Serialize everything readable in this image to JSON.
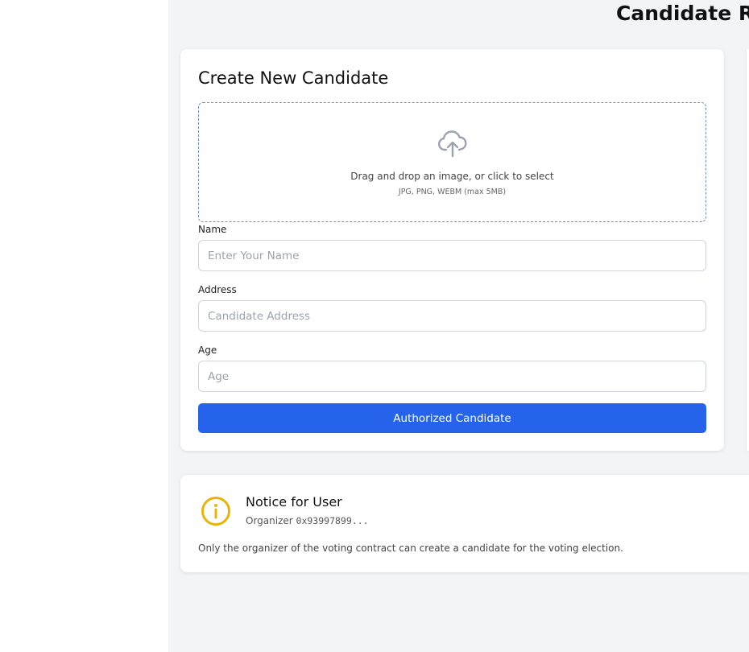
{
  "header": {
    "title": "Candidate Re"
  },
  "form": {
    "title": "Create New Candidate",
    "dropzone": {
      "icon": "cloud-upload-icon",
      "text": "Drag and drop an image, or click to select",
      "hint": "JPG, PNG, WEBM (max 5MB)"
    },
    "fields": {
      "name": {
        "label": "Name",
        "placeholder": "Enter Your Name",
        "value": ""
      },
      "address": {
        "label": "Address",
        "placeholder": "Candidate Address",
        "value": ""
      },
      "age": {
        "label": "Age",
        "placeholder": "Age",
        "value": ""
      }
    },
    "submit_label": "Authorized Candidate"
  },
  "notice": {
    "icon": "info-icon",
    "title": "Notice for User",
    "organizer_label": "Organizer",
    "organizer_address": "0x93997899...",
    "text": "Only the organizer of the voting contract can create a candidate for the voting election."
  },
  "colors": {
    "accent": "#2563eb",
    "background": "#f3f4f6",
    "notice_icon": "#eab308"
  }
}
